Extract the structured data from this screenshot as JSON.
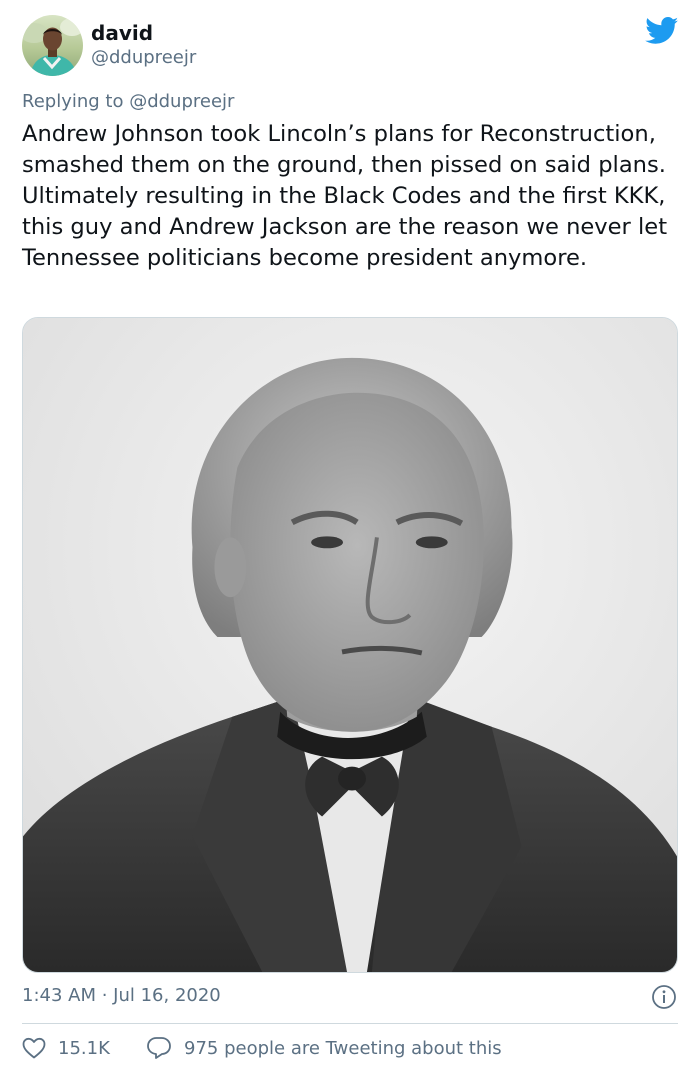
{
  "author": {
    "display_name": "david",
    "handle": "@ddupreejr",
    "avatar_icon": "user-avatar"
  },
  "reply": {
    "text": "Replying to @ddupreejr"
  },
  "tweet": {
    "text": "Andrew Johnson took Lincoln’s plans for Reconstruction, smashed them on the ground, then pissed on said plans. Ultimately resulting in the Black Codes and the first KKK, this guy and Andrew Jackson are the reason we never let Tennessee politicians become president anymore."
  },
  "media": {
    "kind": "black-and-white portrait photo",
    "icon": "portrait-photo"
  },
  "meta": {
    "timestamp": "1:43 AM · Jul 16, 2020"
  },
  "actions": {
    "like_count": "15.1K",
    "conversation_text": "975 people are Tweeting about this"
  },
  "colors": {
    "brand_blue": "#1d9bf0",
    "secondary_text": "#5b7083",
    "divider": "#cfd9de",
    "primary_text": "#0f1419"
  },
  "icons": [
    "twitter-bird-icon",
    "info-icon",
    "heart-icon",
    "speech-bubble-icon"
  ]
}
